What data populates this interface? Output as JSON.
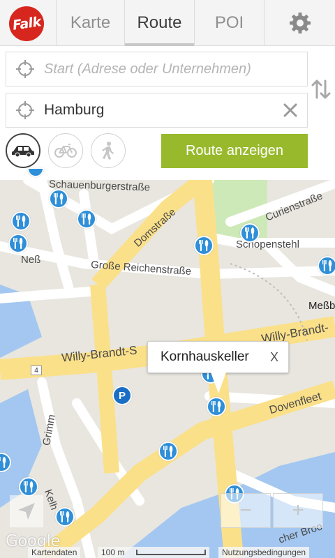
{
  "app": {
    "logo_text": "Falk"
  },
  "tabs": [
    {
      "label": "Karte"
    },
    {
      "label": "Route"
    },
    {
      "label": "POI"
    }
  ],
  "settings": {
    "icon": "gear-icon"
  },
  "route_form": {
    "start_placeholder": "Start (Adrese oder Unternehmen)",
    "destination_value": "Hamburg",
    "submit_label": "Route anzeigen",
    "modes": [
      "car-icon",
      "bicycle-icon",
      "walking-icon"
    ]
  },
  "map": {
    "street_labels": [
      "Schauenburgerstraße",
      "Domstraße",
      "Curienstraße",
      "Schopenstehl",
      "Neß",
      "Große Reichenstraße",
      "Meßb",
      "Willy-Brandt-S",
      "Willy-Brandt-",
      "Dovenfleet",
      "Grimm",
      "Kelh",
      "cher Broo"
    ],
    "road_number": "4",
    "parking_label": "P",
    "popup": {
      "name": "Kornhauskeller",
      "close": "X"
    },
    "zoom_out": "−",
    "zoom_in": "+",
    "google_label": "Google",
    "footer": {
      "map_data": "Kartendaten",
      "scale": "100 m",
      "terms": "Nutzungsbedingungen"
    }
  },
  "colors": {
    "accent_green": "#98b92c",
    "logo_red": "#d7261e",
    "poi_blue": "#2f8fd8",
    "road_yellow": "#fbe08a",
    "water_blue": "#a3c7f0",
    "park_green": "#cde9b8"
  }
}
